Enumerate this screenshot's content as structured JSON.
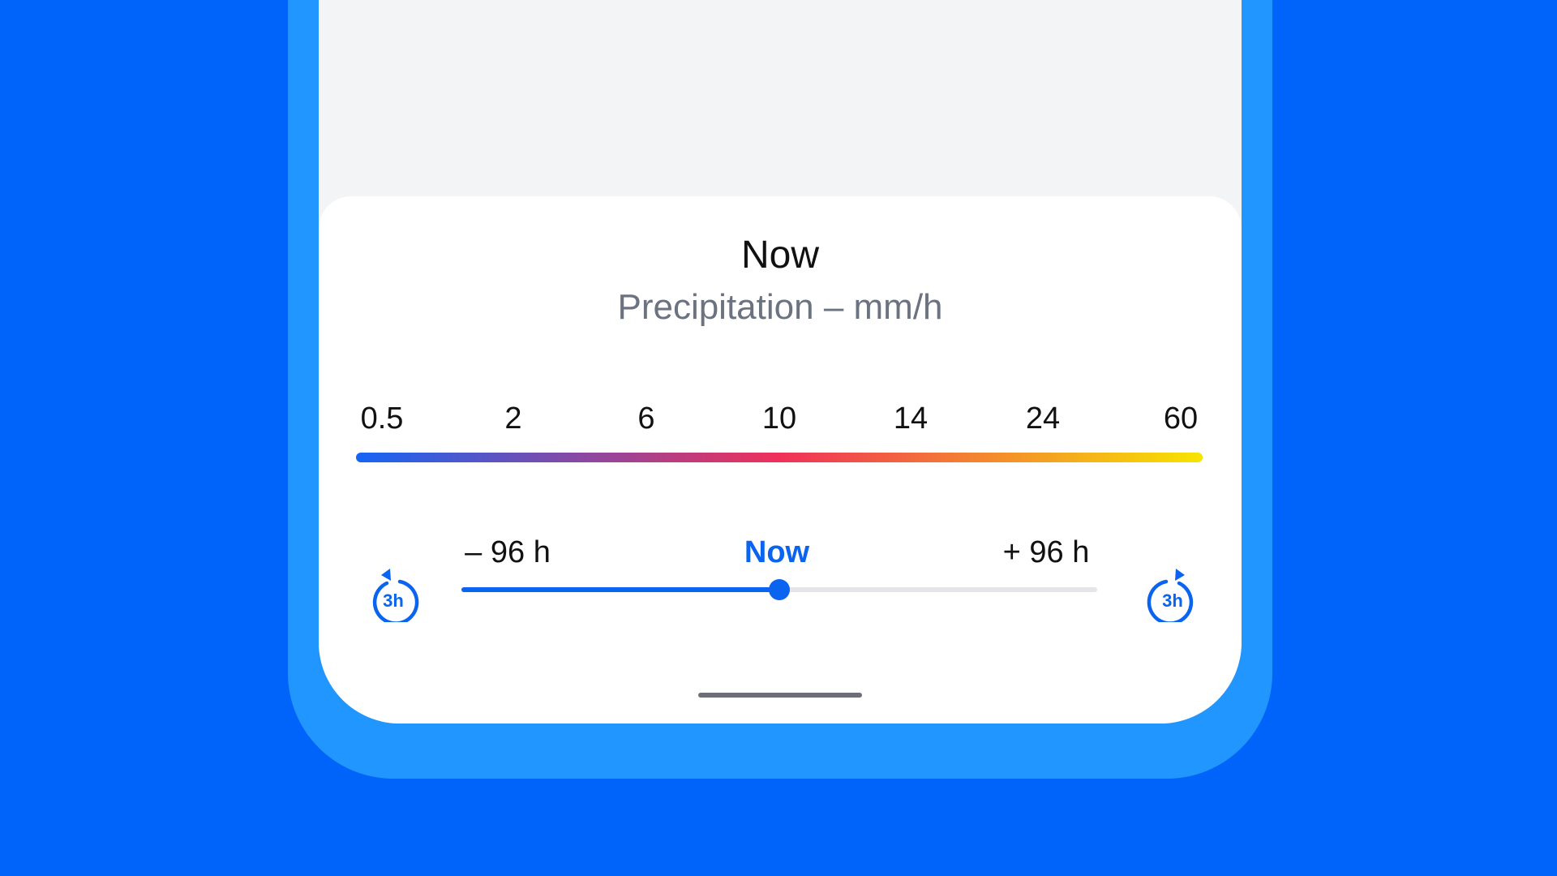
{
  "header": {
    "title": "Now",
    "subtitle": "Precipitation – mm/h"
  },
  "legend": {
    "scale_labels": [
      "0.5",
      "2",
      "6",
      "10",
      "14",
      "24",
      "60"
    ],
    "gradient_colors": [
      "#1565f5",
      "#f0305a",
      "#f7e400"
    ]
  },
  "timeline": {
    "start_label": "– 96 h",
    "current_label": "Now",
    "end_label": "+ 96 h",
    "position_fraction": 0.5,
    "back_button_label": "3h",
    "forward_button_label": "3h"
  },
  "colors": {
    "background": "#0064fa",
    "phone_frame": "#2196ff",
    "accent": "#0a64f0"
  }
}
